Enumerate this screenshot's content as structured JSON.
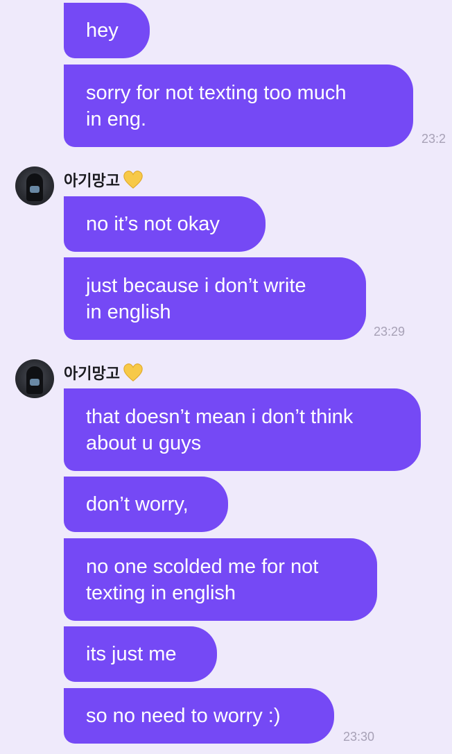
{
  "messages_group_1": {
    "bubbles": [
      {
        "text": "hey"
      },
      {
        "text": "sorry for not texting too much\nin eng."
      }
    ],
    "time": "23:2"
  },
  "messages_group_2": {
    "sender": "아기망고",
    "sender_emoji": "yellow-heart-icon",
    "bubbles": [
      {
        "text": "no it’s not okay"
      },
      {
        "text": "just because i don’t write\nin english"
      }
    ],
    "time": "23:29"
  },
  "messages_group_3": {
    "sender": "아기망고",
    "sender_emoji": "yellow-heart-icon",
    "bubbles": [
      {
        "text": "that doesn’t mean i don’t think\nabout u guys"
      },
      {
        "text": "don’t worry,"
      },
      {
        "text": "no one scolded me for not\ntexting in english"
      },
      {
        "text": "its just me"
      },
      {
        "text": "so no need to worry :)"
      }
    ],
    "time": "23:30"
  },
  "colors": {
    "background": "#efeafb",
    "bubble": "#7549f5",
    "bubble_text": "#ffffff",
    "timestamp": "#a7a1b6",
    "heart": "#f7c948"
  }
}
